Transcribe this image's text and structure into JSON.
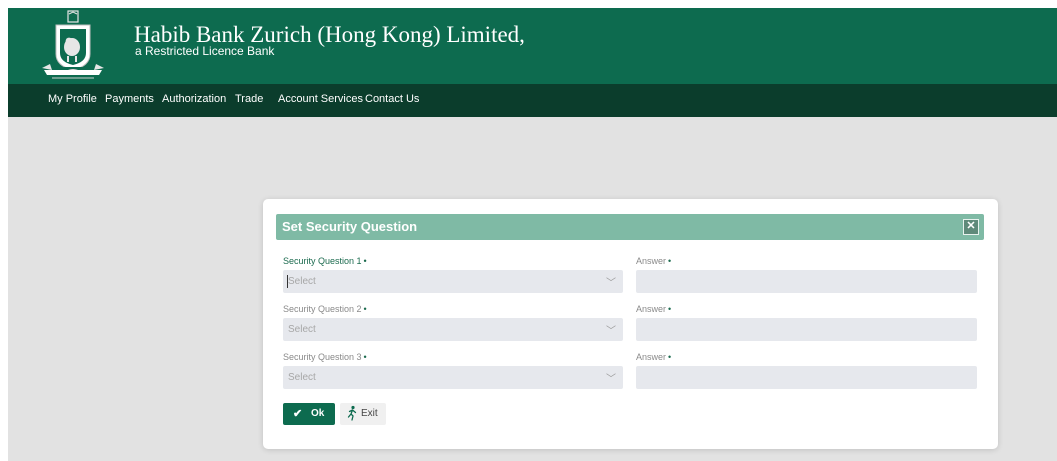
{
  "header": {
    "bank_name": "Habib Bank Zurich (Hong Kong) Limited,",
    "subtitle": "a Restricted Licence Bank",
    "logo_icon": "bank-crest-logo-icon"
  },
  "nav": {
    "items": [
      {
        "label": "My Profile"
      },
      {
        "label": "Payments"
      },
      {
        "label": "Authorization"
      },
      {
        "label": "Trade"
      },
      {
        "label": "Account Services"
      },
      {
        "label": "Contact Us"
      }
    ]
  },
  "modal": {
    "title": "Set Security Question",
    "close_icon": "close-icon",
    "rows": [
      {
        "question_label": "Security Question 1",
        "question_value": "Select",
        "answer_label": "Answer",
        "answer_value": ""
      },
      {
        "question_label": "Security Question 2",
        "question_value": "Select",
        "answer_label": "Answer",
        "answer_value": ""
      },
      {
        "question_label": "Security Question 3",
        "question_value": "Select",
        "answer_label": "Answer",
        "answer_value": ""
      }
    ],
    "required_marker": "•",
    "ok_label": "Ok",
    "exit_label": "Exit"
  },
  "colors": {
    "header_bg": "#0d6b4f",
    "nav_bg": "#0b3d2c",
    "modal_header_bg": "#7fbaa5",
    "page_bg": "#e2e2e2",
    "accent": "#0d6b4f"
  }
}
